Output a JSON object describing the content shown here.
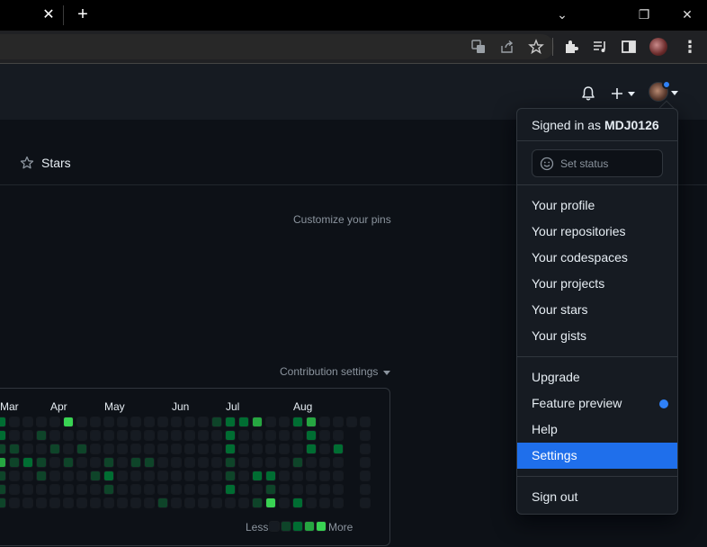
{
  "browser": {
    "tab_close_glyph": "✕",
    "new_tab_glyph": "+",
    "window_buttons": {
      "collapse": "⌄",
      "restore": "❐",
      "close": "✕"
    },
    "kebab_glyph": "⋮"
  },
  "header": {
    "new_glyph": "+"
  },
  "profile_tabs": {
    "stars_label": "Stars"
  },
  "pins": {
    "customize_label": "Customize your pins"
  },
  "contributions": {
    "settings_label": "Contribution settings",
    "months": [
      "Mar",
      "Apr",
      "May",
      "Jun",
      "Jul",
      "Aug"
    ],
    "legend_less": "Less",
    "legend_more": "More",
    "level_colors": [
      "#161b22",
      "#0e4429",
      "#006d32",
      "#26a641",
      "#39d353"
    ]
  },
  "menu": {
    "signed_in_prefix": "Signed in as ",
    "username": "MDJ0126",
    "set_status_label": "Set status",
    "items": [
      {
        "label": "Your profile"
      },
      {
        "label": "Your repositories"
      },
      {
        "label": "Your codespaces"
      },
      {
        "label": "Your projects"
      },
      {
        "label": "Your stars"
      },
      {
        "label": "Your gists"
      },
      {
        "label": "Upgrade"
      },
      {
        "label": "Feature preview"
      },
      {
        "label": "Help"
      },
      {
        "label": "Settings",
        "active": true
      },
      {
        "label": "Sign out"
      }
    ]
  },
  "colors": {
    "page_bg": "#0d1117",
    "header_bg": "#161b22",
    "accent": "#1f6feb",
    "notification_dot": "#2f81f7",
    "border": "#30363d"
  }
}
